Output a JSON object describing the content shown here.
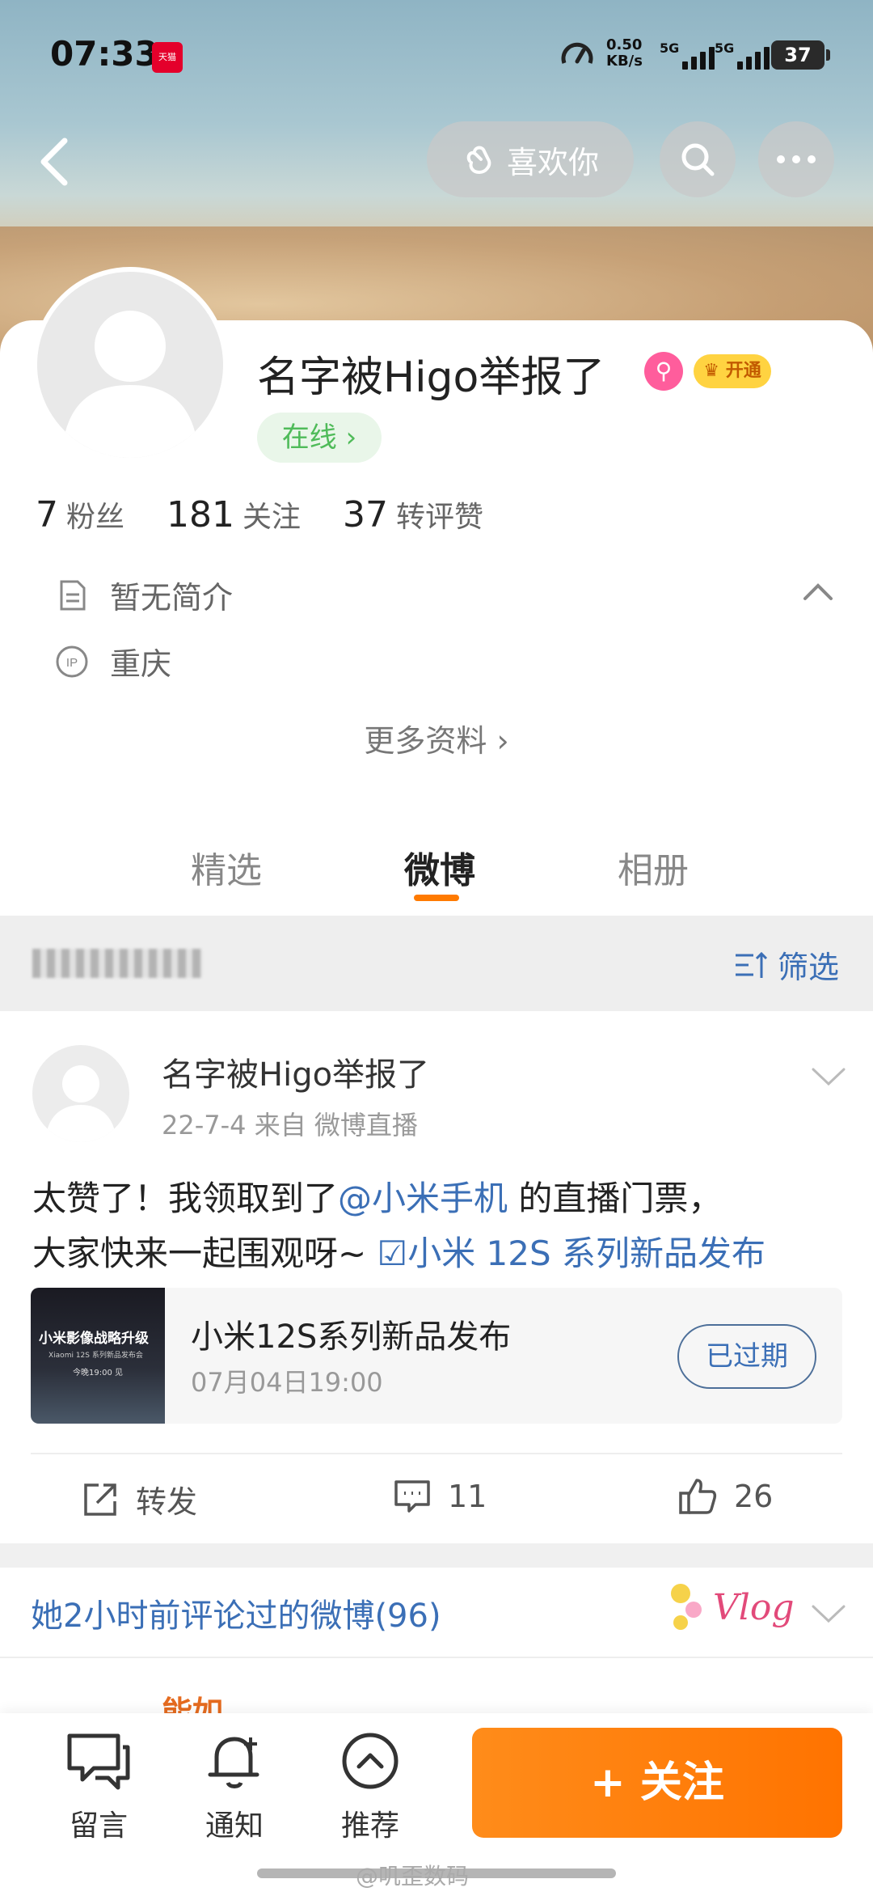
{
  "status_bar": {
    "time": "07:33",
    "app_badge": "天猫",
    "net_speed_value": "0.50",
    "net_speed_unit": "KB/s",
    "signal1_label": "5G",
    "signal2_label": "5G",
    "battery": "37"
  },
  "header": {
    "like_label": "喜欢你"
  },
  "profile": {
    "name": "名字被Higo举报了",
    "vip_label": "开通",
    "online_label": "在线 ›",
    "stats": [
      {
        "num": "7",
        "label": "粉丝"
      },
      {
        "num": "181",
        "label": "关注"
      },
      {
        "num": "37",
        "label": "转评赞"
      }
    ],
    "bio": "暂无简介",
    "ip_location": "重庆",
    "ip_icon_text": "IP",
    "more_info": "更多资料 ›"
  },
  "tabs": [
    "精选",
    "微博",
    "相册"
  ],
  "active_tab": "微博",
  "filter": {
    "label": "筛选"
  },
  "post": {
    "author": "名字被Higo举报了",
    "meta": "22-7-4   来自 微博直播",
    "text_1": "太赞了！我领取到了",
    "mention": "@小米手机",
    "text_2": " 的直播门票，",
    "text_3": "大家快来一起围观呀~ ",
    "event_link": "☑小米 12S 系列新品发布",
    "live_card": {
      "thumb_title": "小米影像战略升级",
      "thumb_sub": "Xiaomi 12S 系列新品发布会",
      "thumb_time": "今晚19:00 见",
      "title": "小米12S系列新品发布",
      "time": "07月04日19:00",
      "status": "已过期"
    },
    "actions": {
      "repost_label": "转发",
      "comment_count": "11",
      "like_count": "26"
    }
  },
  "commented": {
    "label": "她2小时前评论过的微博(96)",
    "sticker_text": "Vlog"
  },
  "next_post": {
    "name_partial": "能如"
  },
  "bottom_bar": {
    "message": "留言",
    "notify": "通知",
    "recommend": "推荐",
    "follow": "+ 关注"
  },
  "watermark": "@叽歪数码",
  "colors": {
    "accent_orange": "#ff7a00",
    "link_blue": "#3b6fb6",
    "online_green": "#4fbb59"
  }
}
